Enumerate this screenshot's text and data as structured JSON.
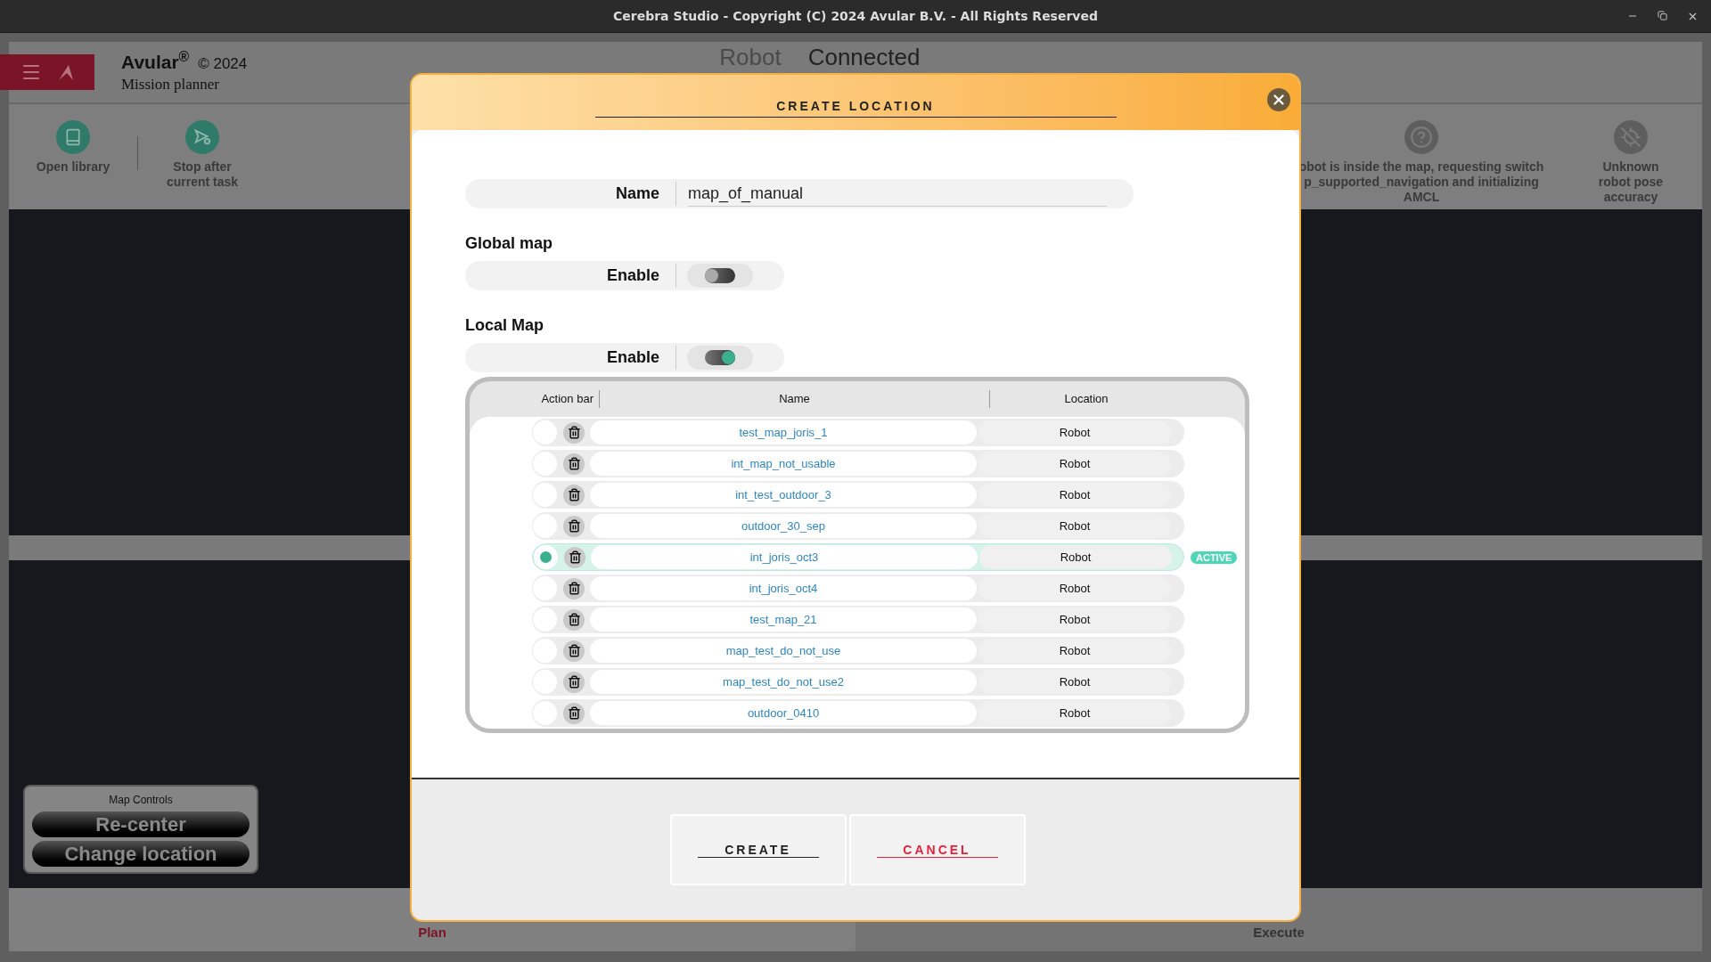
{
  "window": {
    "title": "Cerebra Studio - Copyright (C) 2024 Avular B.V. - All Rights Reserved"
  },
  "header": {
    "brand": "Avular$^{®}$",
    "copyright": "© 2024",
    "subtitle": "Mission planner",
    "status_label": "Robot",
    "status_value": "Connected"
  },
  "toolbar": {
    "left": [
      {
        "kind": "library",
        "label": "Open library"
      },
      {
        "kind": "stop",
        "label": "Stop after current task"
      }
    ],
    "right": [
      {
        "kind": "help",
        "label": "obot is inside the map, requesting switch p_supported_navigation and initializing AMCL"
      },
      {
        "kind": "pose",
        "label": "Unknown robot pose accuracy"
      }
    ]
  },
  "map_controls": {
    "title": "Map Controls",
    "buttons": [
      "Re-center",
      "Change location"
    ]
  },
  "bottom_tabs": [
    {
      "label": "Plan",
      "selected": true
    },
    {
      "label": "Execute",
      "selected": false
    }
  ],
  "dialog": {
    "title": "CREATE LOCATION",
    "name_field": {
      "label": "Name",
      "value": "map_of_manual"
    },
    "sections": [
      {
        "title": "Global map",
        "label": "Enable",
        "on": false
      },
      {
        "title": "Local Map",
        "label": "Enable",
        "on": true
      }
    ],
    "table": {
      "columns": [
        "Action bar",
        "Name",
        "Location"
      ],
      "rows": [
        {
          "name": "test_map_joris_1",
          "location": "Robot",
          "selected": false
        },
        {
          "name": "int_map_not_usable",
          "location": "Robot",
          "selected": false
        },
        {
          "name": "int_test_outdoor_3",
          "location": "Robot",
          "selected": false
        },
        {
          "name": "outdoor_30_sep",
          "location": "Robot",
          "selected": false
        },
        {
          "name": "int_joris_oct3",
          "location": "Robot",
          "selected": true,
          "badge": "ACTIVE"
        },
        {
          "name": "int_joris_oct4",
          "location": "Robot",
          "selected": false
        },
        {
          "name": "test_map_21",
          "location": "Robot",
          "selected": false
        },
        {
          "name": "map_test_do_not_use",
          "location": "Robot",
          "selected": false
        },
        {
          "name": "map_test_do_not_use2",
          "location": "Robot",
          "selected": false
        },
        {
          "name": "outdoor_0410",
          "location": "Robot",
          "selected": false
        }
      ]
    },
    "buttons": [
      {
        "kind": "create",
        "label": "CREATE"
      },
      {
        "kind": "cancel",
        "label": "CANCEL"
      }
    ]
  }
}
